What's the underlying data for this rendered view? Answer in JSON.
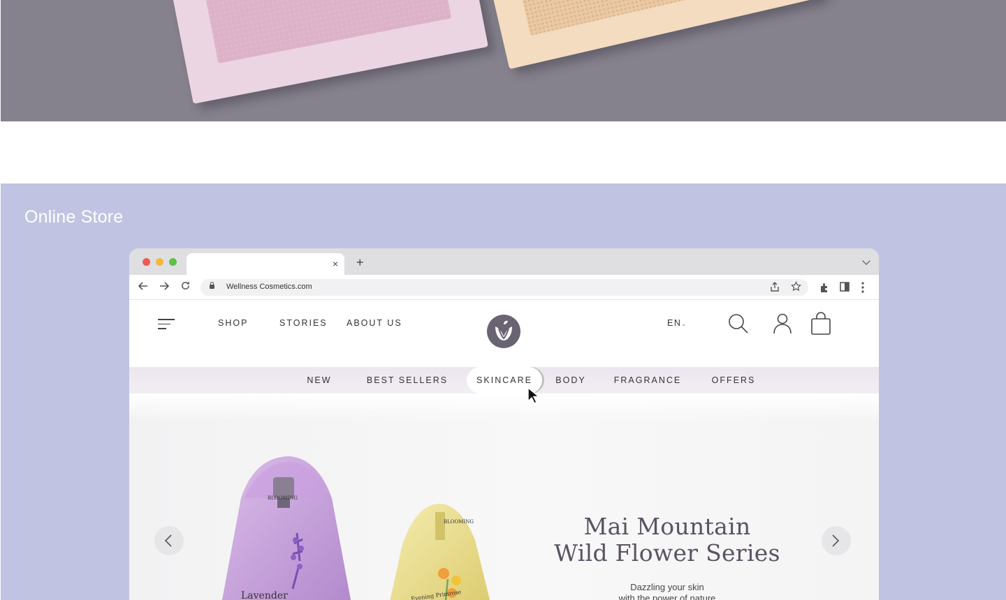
{
  "section": {
    "title": "Online Store"
  },
  "browser": {
    "new_tab_label": "+",
    "tab_close_label": "×",
    "url": "Wellness Cosmetics.com"
  },
  "site": {
    "main_nav": [
      "SHOP",
      "STORIES",
      "ABOUT US"
    ],
    "language": "EN",
    "categories": [
      "NEW",
      "BEST SELLERS",
      "SKINCARE",
      "BODY",
      "FRAGRANCE",
      "OFFERS"
    ],
    "active_category": "SKINCARE"
  },
  "hero": {
    "title_line1": "Mai Mountain",
    "title_line2": "Wild Flower Series",
    "subtitle_line1": "Dazzling your skin",
    "subtitle_line2": "with the power of nature",
    "bottle_left_brand": "BLOOMING",
    "bottle_left_name": "Lavender",
    "bottle_right_brand": "BLOOMING",
    "bottle_right_name": "Evening Primrose"
  },
  "colors": {
    "section_bg": "#c1c3e2",
    "photo_bg": "#85818d",
    "logo": "#6a6371",
    "heading": "#5a5362"
  }
}
